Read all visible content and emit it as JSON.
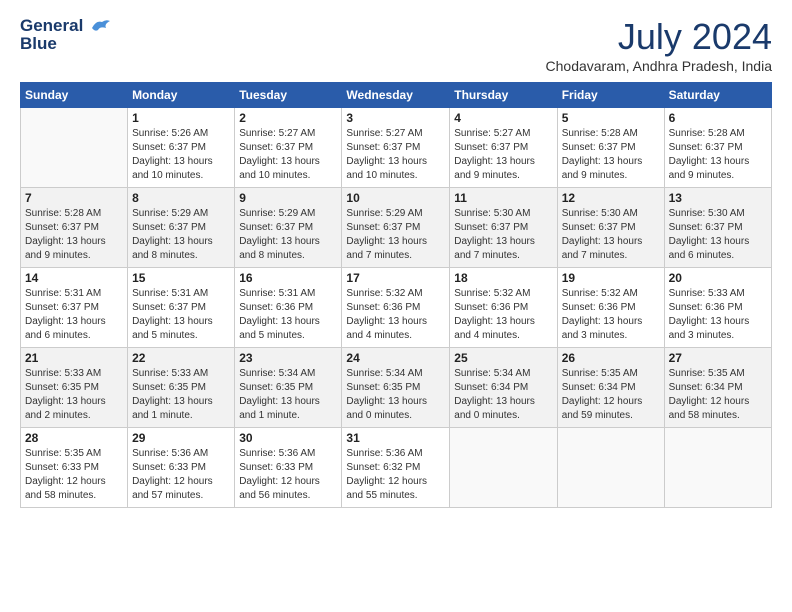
{
  "header": {
    "logo_line1": "General",
    "logo_line2": "Blue",
    "month_year": "July 2024",
    "location": "Chodavaram, Andhra Pradesh, India"
  },
  "weekdays": [
    "Sunday",
    "Monday",
    "Tuesday",
    "Wednesday",
    "Thursday",
    "Friday",
    "Saturday"
  ],
  "weeks": [
    [
      {
        "day": "",
        "info": ""
      },
      {
        "day": "1",
        "info": "Sunrise: 5:26 AM\nSunset: 6:37 PM\nDaylight: 13 hours\nand 10 minutes."
      },
      {
        "day": "2",
        "info": "Sunrise: 5:27 AM\nSunset: 6:37 PM\nDaylight: 13 hours\nand 10 minutes."
      },
      {
        "day": "3",
        "info": "Sunrise: 5:27 AM\nSunset: 6:37 PM\nDaylight: 13 hours\nand 10 minutes."
      },
      {
        "day": "4",
        "info": "Sunrise: 5:27 AM\nSunset: 6:37 PM\nDaylight: 13 hours\nand 9 minutes."
      },
      {
        "day": "5",
        "info": "Sunrise: 5:28 AM\nSunset: 6:37 PM\nDaylight: 13 hours\nand 9 minutes."
      },
      {
        "day": "6",
        "info": "Sunrise: 5:28 AM\nSunset: 6:37 PM\nDaylight: 13 hours\nand 9 minutes."
      }
    ],
    [
      {
        "day": "7",
        "info": "Sunrise: 5:28 AM\nSunset: 6:37 PM\nDaylight: 13 hours\nand 9 minutes."
      },
      {
        "day": "8",
        "info": "Sunrise: 5:29 AM\nSunset: 6:37 PM\nDaylight: 13 hours\nand 8 minutes."
      },
      {
        "day": "9",
        "info": "Sunrise: 5:29 AM\nSunset: 6:37 PM\nDaylight: 13 hours\nand 8 minutes."
      },
      {
        "day": "10",
        "info": "Sunrise: 5:29 AM\nSunset: 6:37 PM\nDaylight: 13 hours\nand 7 minutes."
      },
      {
        "day": "11",
        "info": "Sunrise: 5:30 AM\nSunset: 6:37 PM\nDaylight: 13 hours\nand 7 minutes."
      },
      {
        "day": "12",
        "info": "Sunrise: 5:30 AM\nSunset: 6:37 PM\nDaylight: 13 hours\nand 7 minutes."
      },
      {
        "day": "13",
        "info": "Sunrise: 5:30 AM\nSunset: 6:37 PM\nDaylight: 13 hours\nand 6 minutes."
      }
    ],
    [
      {
        "day": "14",
        "info": "Sunrise: 5:31 AM\nSunset: 6:37 PM\nDaylight: 13 hours\nand 6 minutes."
      },
      {
        "day": "15",
        "info": "Sunrise: 5:31 AM\nSunset: 6:37 PM\nDaylight: 13 hours\nand 5 minutes."
      },
      {
        "day": "16",
        "info": "Sunrise: 5:31 AM\nSunset: 6:36 PM\nDaylight: 13 hours\nand 5 minutes."
      },
      {
        "day": "17",
        "info": "Sunrise: 5:32 AM\nSunset: 6:36 PM\nDaylight: 13 hours\nand 4 minutes."
      },
      {
        "day": "18",
        "info": "Sunrise: 5:32 AM\nSunset: 6:36 PM\nDaylight: 13 hours\nand 4 minutes."
      },
      {
        "day": "19",
        "info": "Sunrise: 5:32 AM\nSunset: 6:36 PM\nDaylight: 13 hours\nand 3 minutes."
      },
      {
        "day": "20",
        "info": "Sunrise: 5:33 AM\nSunset: 6:36 PM\nDaylight: 13 hours\nand 3 minutes."
      }
    ],
    [
      {
        "day": "21",
        "info": "Sunrise: 5:33 AM\nSunset: 6:35 PM\nDaylight: 13 hours\nand 2 minutes."
      },
      {
        "day": "22",
        "info": "Sunrise: 5:33 AM\nSunset: 6:35 PM\nDaylight: 13 hours\nand 1 minute."
      },
      {
        "day": "23",
        "info": "Sunrise: 5:34 AM\nSunset: 6:35 PM\nDaylight: 13 hours\nand 1 minute."
      },
      {
        "day": "24",
        "info": "Sunrise: 5:34 AM\nSunset: 6:35 PM\nDaylight: 13 hours\nand 0 minutes."
      },
      {
        "day": "25",
        "info": "Sunrise: 5:34 AM\nSunset: 6:34 PM\nDaylight: 13 hours\nand 0 minutes."
      },
      {
        "day": "26",
        "info": "Sunrise: 5:35 AM\nSunset: 6:34 PM\nDaylight: 12 hours\nand 59 minutes."
      },
      {
        "day": "27",
        "info": "Sunrise: 5:35 AM\nSunset: 6:34 PM\nDaylight: 12 hours\nand 58 minutes."
      }
    ],
    [
      {
        "day": "28",
        "info": "Sunrise: 5:35 AM\nSunset: 6:33 PM\nDaylight: 12 hours\nand 58 minutes."
      },
      {
        "day": "29",
        "info": "Sunrise: 5:36 AM\nSunset: 6:33 PM\nDaylight: 12 hours\nand 57 minutes."
      },
      {
        "day": "30",
        "info": "Sunrise: 5:36 AM\nSunset: 6:33 PM\nDaylight: 12 hours\nand 56 minutes."
      },
      {
        "day": "31",
        "info": "Sunrise: 5:36 AM\nSunset: 6:32 PM\nDaylight: 12 hours\nand 55 minutes."
      },
      {
        "day": "",
        "info": ""
      },
      {
        "day": "",
        "info": ""
      },
      {
        "day": "",
        "info": ""
      }
    ]
  ]
}
